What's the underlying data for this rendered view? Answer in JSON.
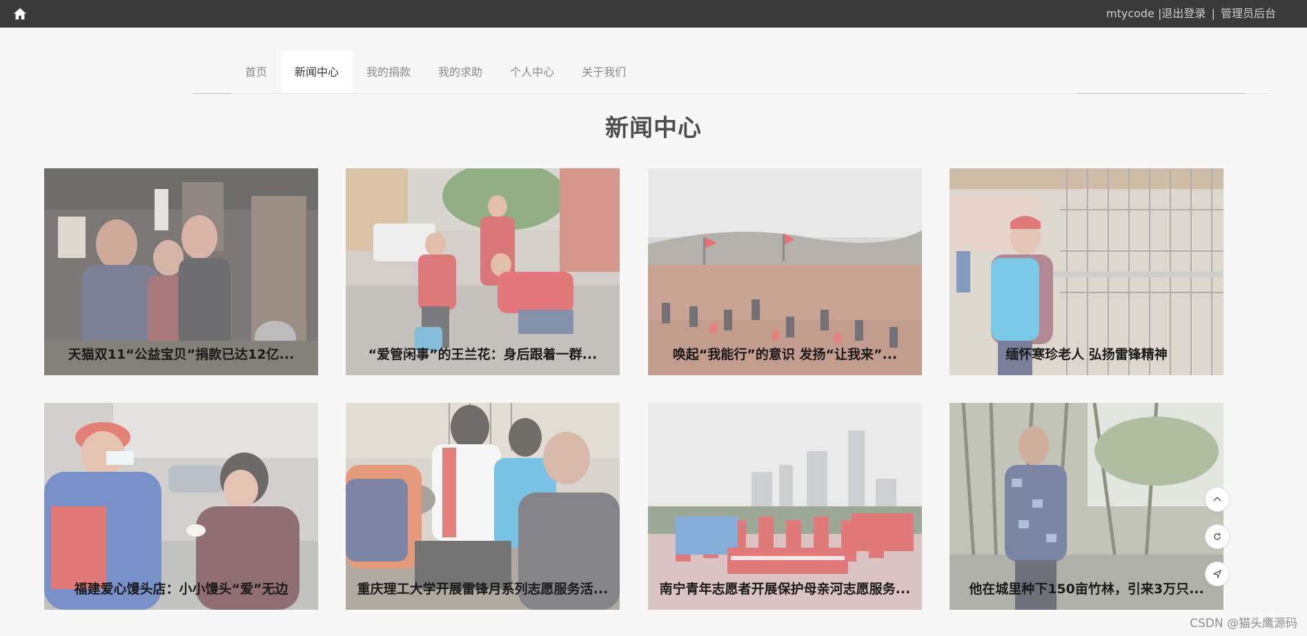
{
  "topbar": {
    "username": "mtycode",
    "logout": "|退出登录",
    "admin": "管理员后台",
    "separator": "|"
  },
  "nav": {
    "items": [
      {
        "label": "首页"
      },
      {
        "label": "新闻中心"
      },
      {
        "label": "我的捐款"
      },
      {
        "label": "我的求助"
      },
      {
        "label": "个人中心"
      },
      {
        "label": "关于我们"
      }
    ],
    "active_index": 1
  },
  "page_title": "新闻中心",
  "news": [
    {
      "title": "天猫双11“公益宝贝”捐款已达12亿...",
      "scene": "family indoors"
    },
    {
      "title": "“爱管闲事”的王兰花：身后跟着一群...",
      "scene": "volunteers street"
    },
    {
      "title": "唤起“我能行”的意识 发扬“让我来”...",
      "scene": "volunteers hillside"
    },
    {
      "title": "缅怀寒珍老人 弘扬雷锋精神",
      "scene": "volunteer bridge"
    },
    {
      "title": "福建爱心馒头店：小小馒头“爱”无边",
      "scene": "handing buns"
    },
    {
      "title": "重庆理工大学开展雷锋月系列志愿服务活...",
      "scene": "repair service"
    },
    {
      "title": "南宁青年志愿者开展保护母亲河志愿服务...",
      "scene": "group banner"
    },
    {
      "title": "他在城里种下150亩竹林，引来3万只...",
      "scene": "bamboo forest"
    }
  ],
  "floating_buttons": [
    "arrow-up-icon",
    "refresh-icon",
    "send-icon"
  ],
  "watermark": "CSDN @猫头鹰源码",
  "colors": {
    "topbar": "#3a3a3a",
    "background": "#f7f7f7",
    "title": "#4d4d4d"
  }
}
